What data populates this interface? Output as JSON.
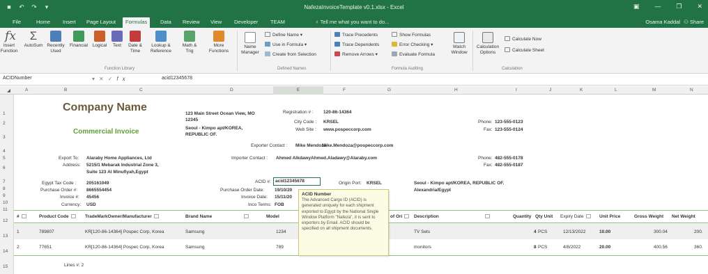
{
  "window": {
    "title": "NafezaInvoiceTemplate v0.1.xlsx - Excel",
    "user": "Osama Kaddal",
    "share": "Share"
  },
  "ribbon_tabs": [
    "File",
    "Home",
    "Insert",
    "Page Layout",
    "Formulas",
    "Data",
    "Review",
    "View",
    "Developer",
    "TEAM"
  ],
  "active_tab": "Formulas",
  "tell_me": "Tell me what you want to do...",
  "ribbon": {
    "insert_function": "Insert Function",
    "autosum": "AutoSum",
    "recently_used": "Recently Used",
    "financial": "Financial",
    "logical": "Logical",
    "text": "Text",
    "date_time": "Date & Time",
    "lookup_reference": "Lookup & Reference",
    "math_trig": "Math & Trig",
    "more_functions": "More Functions",
    "function_library": "Function Library",
    "name_manager": "Name Manager",
    "define_name": "Define Name",
    "use_in_formula": "Use in Formula",
    "create_from_selection": "Create from Selection",
    "defined_names": "Defined Names",
    "trace_precedents": "Trace Precedents",
    "trace_dependents": "Trace Dependents",
    "remove_arrows": "Remove Arrows",
    "show_formulas": "Show Formulas",
    "error_checking": "Error Checking",
    "evaluate_formula": "Evaluate Formula",
    "watch_window": "Watch Window",
    "formula_auditing": "Formula Auditing",
    "calculation_options": "Calculation Options",
    "calculate_now": "Calculate Now",
    "calculate_sheet": "Calculate Sheet",
    "calculation": "Calculation"
  },
  "formula_bar": {
    "name_box": "ACIDNumber",
    "fx": "fx",
    "value": "acid12345678"
  },
  "columns": [
    "A",
    "B",
    "C",
    "D",
    "E",
    "F",
    "G",
    "H",
    "I",
    "J",
    "K",
    "L",
    "M",
    "N"
  ],
  "selected_column": "E",
  "rows": [
    "1",
    "2",
    "3",
    "4",
    "5",
    "6",
    "7",
    "8",
    "9",
    "10",
    "11",
    "12",
    "13",
    "14",
    "15"
  ],
  "sheet": {
    "company_name": "Company Name",
    "commercial_invoice": "Commercial Invoice",
    "address_1": "123 Main Street Ocean View, MO",
    "address_2": "12345",
    "address_3": "Seoul - Kimpo apt/KOREA,",
    "address_4": "REPUBLIC OF.",
    "registration_label": "Registration # :",
    "registration_value": "120-86-14364",
    "city_code_label": "City Code :",
    "city_code_value": "KRSEL",
    "website_label": "Web Site :",
    "website_value": "www.pospeccorp.com",
    "phone_label_1": "Phone:",
    "phone_value_1": "123-555-0123",
    "fax_label_1": "Fax:",
    "fax_value_1": "123-555-0124",
    "exporter_contact_label": "Exporter Contact :",
    "exporter_contact_name": "Mike Mendoza",
    "exporter_contact_email": "Mike.Mendoza@pospeccorp.com",
    "export_to_label": "Export To:",
    "export_to_value": "Alaraby Home Appliances, Ltd",
    "address_label": "Address:",
    "address_value_1": "5215/1 Mebarak Industrial Zone 3,",
    "address_value_2": "Suite 123 Al Minufiyah,Egypt",
    "importer_contact_label": "Importer Contact :",
    "importer_contact_name": "Ahmed Alkdawy",
    "importer_contact_email": "Ahmed.Aladawy@Alaraby.com",
    "phone_label_2": "Phone:",
    "phone_value_2": "482-555-0178",
    "fax_label_2": "Fax:",
    "fax_value_2": "482-555-0187",
    "egypt_tax_label": "Egypt Tax Code :",
    "egypt_tax_value": "205161049",
    "po_label": "Purchase Order #:",
    "po_value": "8665554454",
    "invoice_no_label": "Invoice #:",
    "invoice_no_value": "45456",
    "currency_label": "Currency:",
    "currency_value": "USD",
    "acid_label": "ACID #:",
    "acid_value": "acid12345678",
    "po_date_label": "Purchase Order Date:",
    "po_date_value": "19/10/20",
    "invoice_date_label": "Invoice Date:",
    "invoice_date_value": "15/11/20",
    "inco_terms_label": "Inco Terms:",
    "inco_terms_value": "FOB",
    "origin_port_label": "Origin Port:",
    "origin_port_value": "KRSEL",
    "origin_addr_1": "Seoul - Kimpo apt/KOREA, REPUBLIC OF.",
    "origin_addr_2": "Alexandria/Egypt",
    "lines_label": "Lines #: 2"
  },
  "table": {
    "headers": {
      "num": "#",
      "product_code": "Product Code",
      "trademark": "TradeMarkOwner/Manufacturer",
      "brand": "Brand Name",
      "model": "Model",
      "origin": "of Ori",
      "description": "Description",
      "quantity": "Quantity",
      "qty_unit": "Qty Unit",
      "expiry": "Expiry Date",
      "unit_price": "Unit Price",
      "gross_weight": "Gross Weight",
      "net_weight": "Net Weight"
    },
    "rows": [
      {
        "num": "1",
        "product_code": "789807",
        "trademark": "KR[120-86-14364] Pospec Corp, Korea",
        "brand": "Samsung",
        "model": "1234",
        "description": "TV Sets",
        "quantity": "4",
        "qty_unit": "PCS",
        "expiry": "12/13/2022",
        "unit_price": "10.00",
        "gross_weight": "300.04",
        "net_weight": "200."
      },
      {
        "num": "2",
        "product_code": "77651",
        "trademark": "KR[120-86-14364] Pospec Corp, Korea",
        "brand": "Samsung",
        "model": "789",
        "description": "monitors",
        "quantity": "8",
        "qty_unit": "PCS",
        "expiry": "4/8/2022",
        "unit_price": "20.00",
        "gross_weight": "400.56",
        "net_weight": "360."
      }
    ]
  },
  "tooltip": {
    "title": "ACID Number",
    "body": "The Advanced Cargo ID (ACID) is generated uniquely for each shipment exported to Egypt by the National Single Window Platform \"Nafeza\", it is sent to exporters by Email. ACID should be specified on all shipment documents."
  },
  "colors": {
    "excel_green": "#217346",
    "company": "#6b5a3a",
    "invoice": "#5f9e3a",
    "tooltip_bg": "#fcfbe3"
  }
}
